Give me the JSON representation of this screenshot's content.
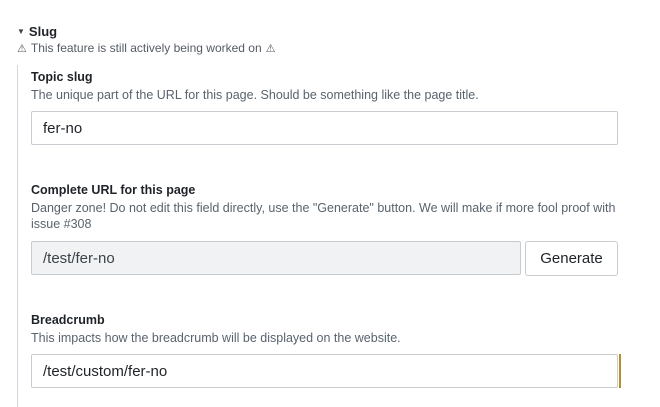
{
  "section": {
    "title": "Slug",
    "warning_icon": "warning-triangle-icon",
    "warning_text": "This feature is still actively being worked on"
  },
  "topic_slug": {
    "label": "Topic slug",
    "help": "The unique part of the URL for this page. Should be something like the page title.",
    "value": "fer-no"
  },
  "complete_url": {
    "label": "Complete URL for this page",
    "help": "Danger zone! Do not edit this field directly, use the \"Generate\" button. We will make if more fool proof with issue #308",
    "value": "/test/fer-no",
    "button_label": "Generate"
  },
  "breadcrumb": {
    "label": "Breadcrumb",
    "help": "This impacts how the breadcrumb will be displayed on the website.",
    "value": "/test/custom/fer-no"
  }
}
